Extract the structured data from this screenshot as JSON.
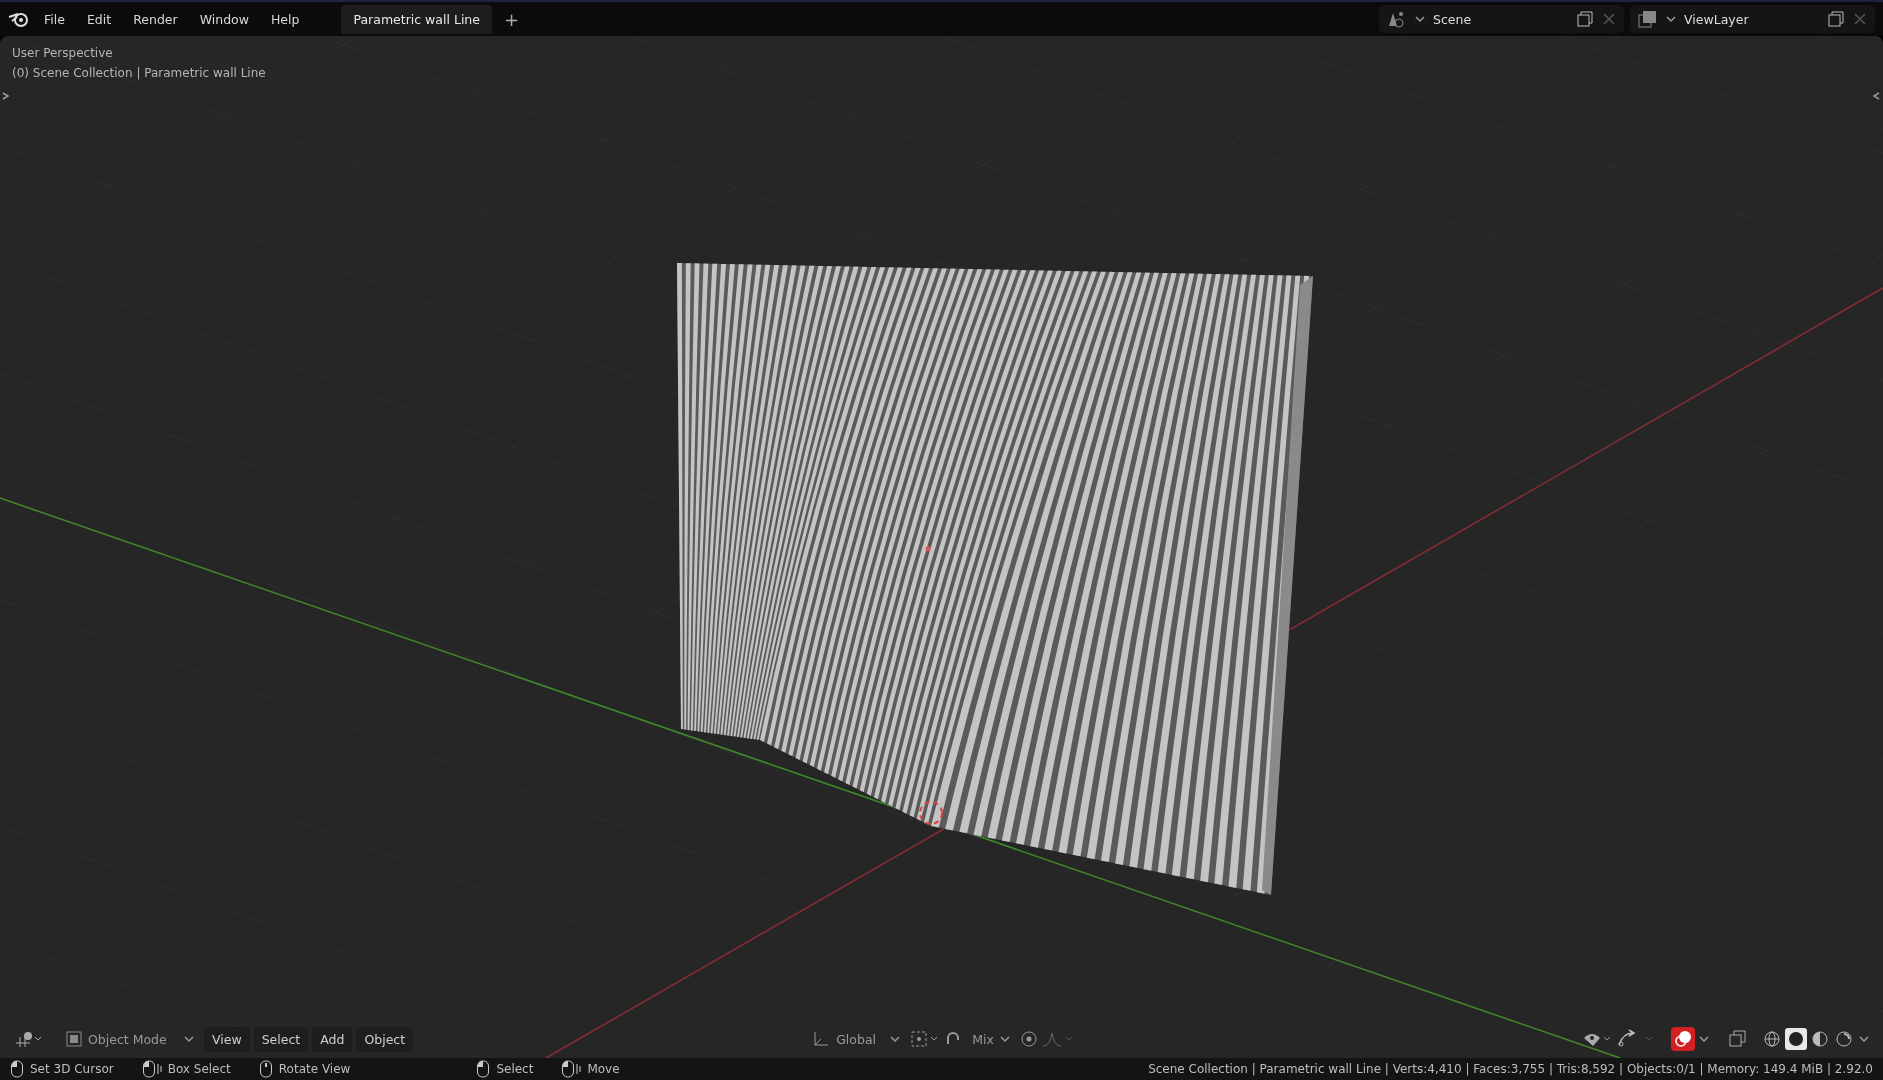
{
  "top_bar": {
    "menus": [
      "File",
      "Edit",
      "Render",
      "Window",
      "Help"
    ],
    "workspace_tabs": [
      {
        "label": "Parametric wall Line",
        "selected": true
      }
    ],
    "add_tab": "+",
    "scene": "Scene",
    "view_layer": "ViewLayer"
  },
  "viewport": {
    "view_name": "User Perspective",
    "collection_info": "(0) Scene Collection | Parametric wall Line"
  },
  "header": {
    "mode": "Object Mode",
    "menus": [
      "View",
      "Select",
      "Add",
      "Object"
    ],
    "transform_orientation": "Global",
    "snap_target": "Mix",
    "overlay_on": true,
    "shading": [
      {
        "kind": "wireframe",
        "selected": false
      },
      {
        "kind": "solid",
        "selected": true
      },
      {
        "kind": "material",
        "selected": false
      },
      {
        "kind": "rendered",
        "selected": false
      }
    ]
  },
  "status_bar": {
    "hints": [
      {
        "label": "Set 3D Cursor",
        "kind": "left-click"
      },
      {
        "label": "Box Select",
        "kind": "left-drag"
      },
      {
        "label": "Rotate View",
        "kind": "middle-click"
      },
      {
        "label": "Select",
        "kind": "left-click"
      },
      {
        "label": "Move",
        "kind": "left-drag"
      }
    ],
    "stats": "Scene Collection | Parametric wall Line | Verts:4,410 | Faces:3,755 | Tris:8,592 | Objects:0/1 | Memory: 149.4 MiB | 2.92.0"
  }
}
